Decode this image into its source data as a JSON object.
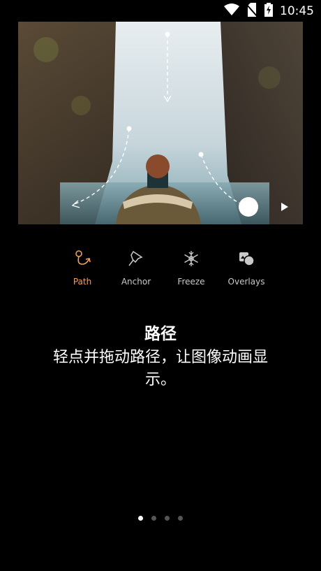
{
  "status": {
    "time": "10:45",
    "icons": [
      "wifi-icon",
      "no-sim-icon",
      "battery-charging-icon"
    ]
  },
  "hero": {
    "image": "waterfall-person",
    "controls": [
      "play-icon"
    ]
  },
  "tools": [
    {
      "label": "Path",
      "icon": "path-icon",
      "active": true
    },
    {
      "label": "Anchor",
      "icon": "anchor-pin-icon",
      "active": false
    },
    {
      "label": "Freeze",
      "icon": "snowflake-icon",
      "active": false
    },
    {
      "label": "Overlays",
      "icon": "overlays-icon",
      "active": false
    }
  ],
  "onboarding": {
    "title": "路径",
    "description": "轻点并拖动路径，让图像动画显示。"
  },
  "pager": {
    "total": 4,
    "current": 1
  },
  "colors": {
    "accent": "#f0a058",
    "background": "#000000"
  }
}
